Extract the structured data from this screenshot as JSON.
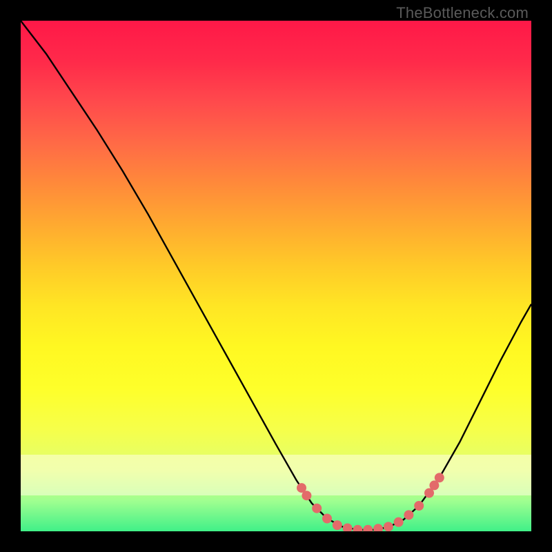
{
  "watermark": "TheBottleneck.com",
  "chart_data": {
    "type": "line",
    "title": "",
    "xlabel": "",
    "ylabel": "",
    "xlim": [
      0,
      100
    ],
    "ylim": [
      0,
      100
    ],
    "curve": [
      {
        "x": 0.0,
        "y": 100.0
      },
      {
        "x": 5.0,
        "y": 93.5
      },
      {
        "x": 10.0,
        "y": 86.0
      },
      {
        "x": 15.0,
        "y": 78.5
      },
      {
        "x": 20.0,
        "y": 70.5
      },
      {
        "x": 25.0,
        "y": 62.0
      },
      {
        "x": 30.0,
        "y": 53.0
      },
      {
        "x": 35.0,
        "y": 44.0
      },
      {
        "x": 40.0,
        "y": 35.0
      },
      {
        "x": 45.0,
        "y": 26.0
      },
      {
        "x": 50.0,
        "y": 17.0
      },
      {
        "x": 54.0,
        "y": 10.0
      },
      {
        "x": 57.0,
        "y": 5.5
      },
      {
        "x": 60.0,
        "y": 2.5
      },
      {
        "x": 63.0,
        "y": 0.9
      },
      {
        "x": 66.0,
        "y": 0.3
      },
      {
        "x": 69.0,
        "y": 0.3
      },
      {
        "x": 72.0,
        "y": 0.8
      },
      {
        "x": 75.0,
        "y": 2.3
      },
      {
        "x": 78.0,
        "y": 5.0
      },
      {
        "x": 82.0,
        "y": 10.5
      },
      {
        "x": 86.0,
        "y": 17.5
      },
      {
        "x": 90.0,
        "y": 25.5
      },
      {
        "x": 94.0,
        "y": 33.5
      },
      {
        "x": 98.0,
        "y": 41.0
      },
      {
        "x": 100.0,
        "y": 44.5
      }
    ],
    "markers": [
      {
        "x": 55.0,
        "y": 8.5
      },
      {
        "x": 56.0,
        "y": 7.0
      },
      {
        "x": 58.0,
        "y": 4.5
      },
      {
        "x": 60.0,
        "y": 2.5
      },
      {
        "x": 62.0,
        "y": 1.2
      },
      {
        "x": 64.0,
        "y": 0.6
      },
      {
        "x": 66.0,
        "y": 0.3
      },
      {
        "x": 68.0,
        "y": 0.3
      },
      {
        "x": 70.0,
        "y": 0.5
      },
      {
        "x": 72.0,
        "y": 0.9
      },
      {
        "x": 74.0,
        "y": 1.8
      },
      {
        "x": 76.0,
        "y": 3.2
      },
      {
        "x": 78.0,
        "y": 5.0
      },
      {
        "x": 80.0,
        "y": 7.5
      },
      {
        "x": 81.0,
        "y": 9.0
      },
      {
        "x": 82.0,
        "y": 10.5
      }
    ],
    "pale_band_y": [
      7,
      15
    ],
    "marker_color": "#e36a6a",
    "curve_color": "#000000"
  }
}
